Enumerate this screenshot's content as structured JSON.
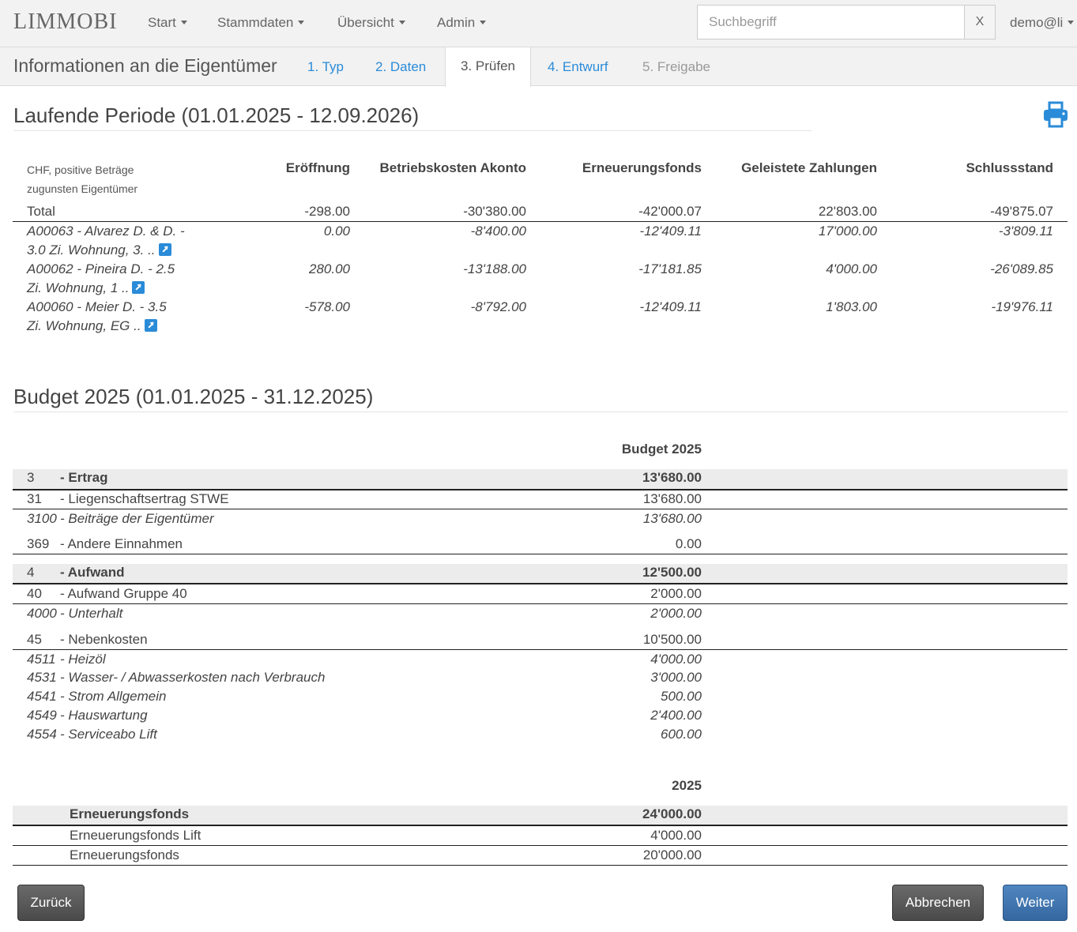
{
  "navbar": {
    "brand": "LIMMOBI",
    "menu": [
      {
        "label": "Start"
      },
      {
        "label": "Stammdaten"
      },
      {
        "label": "Übersicht"
      },
      {
        "label": "Admin"
      }
    ],
    "search_placeholder": "Suchbegriff",
    "search_clear": "X",
    "user": "demo@li"
  },
  "wizard": {
    "title": "Informationen an die Eigentümer",
    "steps": [
      {
        "label": "1. Typ",
        "state": "link"
      },
      {
        "label": "2. Daten",
        "state": "link"
      },
      {
        "label": "3. Prüfen",
        "state": "active"
      },
      {
        "label": "4. Entwurf",
        "state": "link"
      },
      {
        "label": "5. Freigabe",
        "state": "disabled"
      }
    ]
  },
  "period": {
    "title": "Laufende Periode (01.01.2025 - 12.09.2026)",
    "note_line1": "CHF, positive Beträge",
    "note_line2": "zugunsten Eigentümer",
    "columns": [
      "Eröffnung",
      "Betriebskosten Akonto",
      "Erneuerungsfonds",
      "Geleistete Zahlungen",
      "Schlussstand"
    ],
    "total": {
      "label": "Total",
      "values": [
        "-298.00",
        "-30'380.00",
        "-42'000.07",
        "22'803.00",
        "-49'875.07"
      ]
    },
    "rows": [
      {
        "line1": "A00063 - Alvarez D. & D. -",
        "line2": "3.0 Zi. Wohnung, 3. ..",
        "values": [
          "0.00",
          "-8'400.00",
          "-12'409.11",
          "17'000.00",
          "-3'809.11"
        ]
      },
      {
        "line1": "A00062 - Pineira D. - 2.5",
        "line2": "Zi. Wohnung, 1 ..",
        "values": [
          "280.00",
          "-13'188.00",
          "-17'181.85",
          "4'000.00",
          "-26'089.85"
        ]
      },
      {
        "line1": "A00060 - Meier D. - 3.5",
        "line2": "Zi. Wohnung, EG ..",
        "values": [
          "-578.00",
          "-8'792.00",
          "-12'409.11",
          "1'803.00",
          "-19'976.11"
        ]
      }
    ]
  },
  "budget": {
    "title": "Budget 2025 (01.01.2025 - 31.12.2025)",
    "column": "Budget 2025",
    "rows": [
      {
        "num": "3",
        "label": "- Ertrag",
        "value": "13'680.00",
        "kind": "group"
      },
      {
        "num": "31",
        "label": "- Liegenschaftsertrag STWE",
        "value": "13'680.00",
        "kind": "sub"
      },
      {
        "num": "3100",
        "label": "- Beiträge der Eigentümer",
        "value": "13'680.00",
        "kind": "acct"
      },
      {
        "num": "369",
        "label": "- Andere Einnahmen",
        "value": "0.00",
        "kind": "sub"
      },
      {
        "num": "4",
        "label": "- Aufwand",
        "value": "12'500.00",
        "kind": "group"
      },
      {
        "num": "40",
        "label": "- Aufwand Gruppe 40",
        "value": "2'000.00",
        "kind": "sub"
      },
      {
        "num": "4000",
        "label": "- Unterhalt",
        "value": "2'000.00",
        "kind": "acct"
      },
      {
        "num": "45",
        "label": "- Nebenkosten",
        "value": "10'500.00",
        "kind": "sub"
      },
      {
        "num": "4511",
        "label": "- Heizöl",
        "value": "4'000.00",
        "kind": "acct"
      },
      {
        "num": "4531",
        "label": "- Wasser- / Abwasserkosten nach Verbrauch",
        "value": "3'000.00",
        "kind": "acct"
      },
      {
        "num": "4541",
        "label": "- Strom Allgemein",
        "value": "500.00",
        "kind": "acct"
      },
      {
        "num": "4549",
        "label": "- Hauswartung",
        "value": "2'400.00",
        "kind": "acct"
      },
      {
        "num": "4554",
        "label": "- Serviceabo Lift",
        "value": "600.00",
        "kind": "acct"
      }
    ]
  },
  "fonds": {
    "column": "2025",
    "rows": [
      {
        "label": "Erneuerungsfonds",
        "value": "24'000.00",
        "kind": "group"
      },
      {
        "label": "Erneuerungsfonds Lift",
        "value": "4'000.00",
        "kind": "item"
      },
      {
        "label": "Erneuerungsfonds",
        "value": "20'000.00",
        "kind": "item"
      }
    ]
  },
  "buttons": {
    "back": "Zurück",
    "cancel": "Abbrechen",
    "next": "Weiter"
  },
  "colors": {
    "accent": "#2a8bd8",
    "primary_button": "#3567a0",
    "secondary_button": "#4a4a4a"
  }
}
